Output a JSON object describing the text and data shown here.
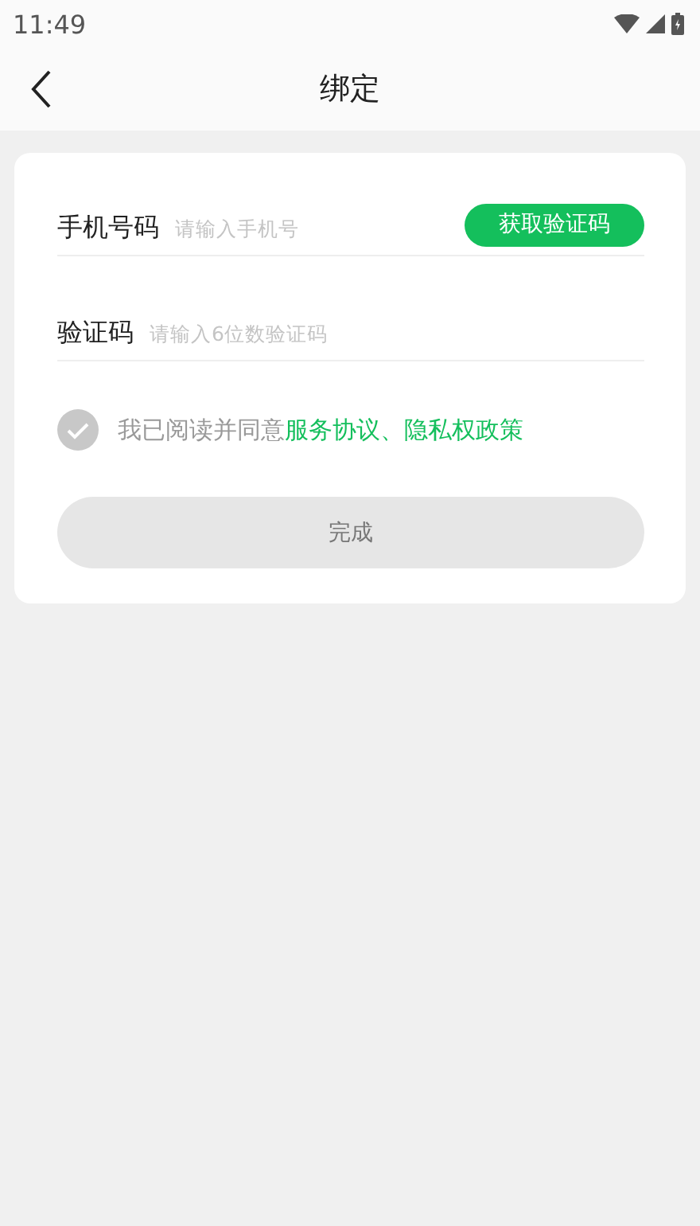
{
  "status_bar": {
    "time": "11:49"
  },
  "nav_bar": {
    "title": "绑定"
  },
  "form": {
    "phone": {
      "label": "手机号码",
      "placeholder": "请输入手机号",
      "button": "获取验证码"
    },
    "code": {
      "label": "验证码",
      "placeholder": "请输入6位数验证码"
    },
    "agreement": {
      "checked": false,
      "text": "我已阅读并同意",
      "link": "服务协议、隐私权政策"
    },
    "submit": {
      "label": "完成",
      "disabled": true
    }
  }
}
